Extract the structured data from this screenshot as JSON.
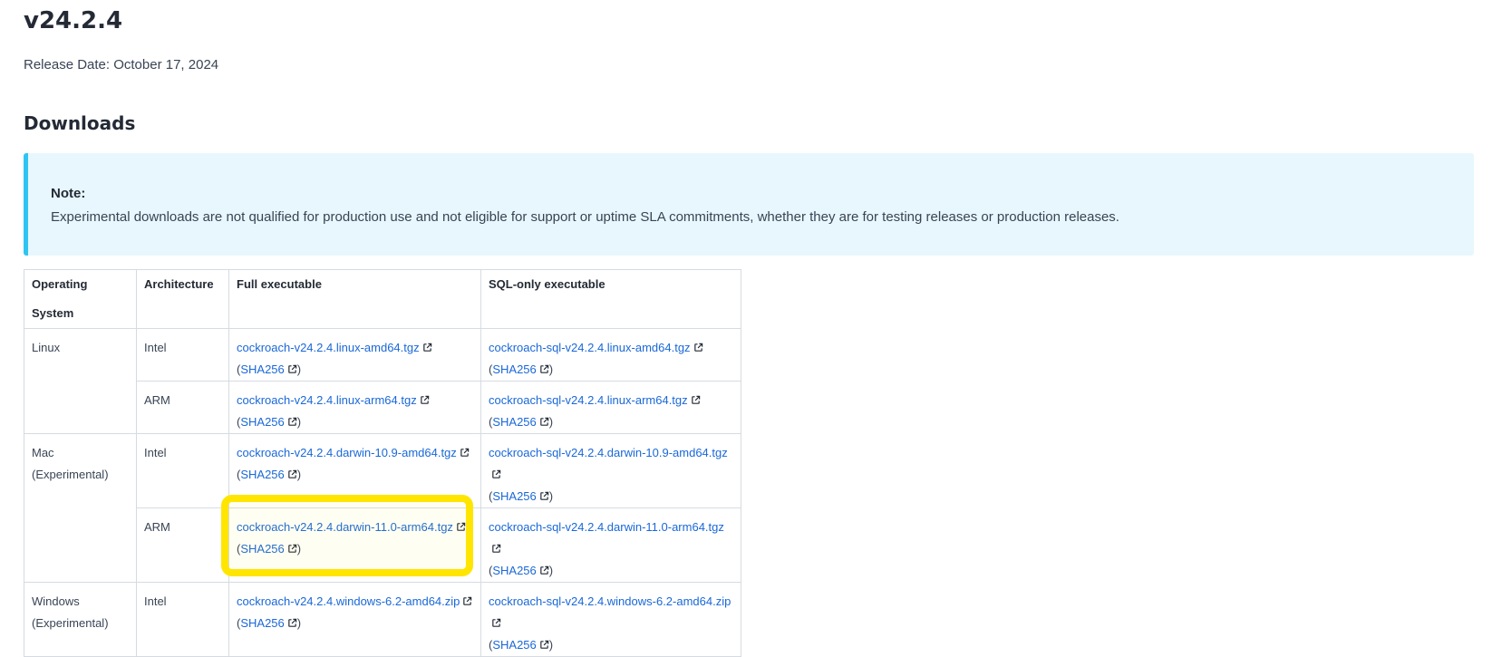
{
  "version_title": "v24.2.4",
  "release_date": "Release Date: October 17, 2024",
  "downloads_heading": "Downloads",
  "note": {
    "title": "Note:",
    "text": "Experimental downloads are not qualified for production use and not eligible for support or uptime SLA commitments, whether they are for testing releases or production releases."
  },
  "table": {
    "headers": [
      "Operating System",
      "Architecture",
      "Full executable",
      "SQL-only executable"
    ],
    "sha_label": "SHA256",
    "rows": [
      {
        "os": "Linux",
        "os_sub": "",
        "arch": "Intel",
        "full": "cockroach-v24.2.4.linux-amd64.tgz",
        "sql": "cockroach-sql-v24.2.4.linux-amd64.tgz"
      },
      {
        "os": "",
        "os_sub": "",
        "arch": "ARM",
        "full": "cockroach-v24.2.4.linux-arm64.tgz",
        "sql": "cockroach-sql-v24.2.4.linux-arm64.tgz"
      },
      {
        "os": "Mac",
        "os_sub": "(Experimental)",
        "arch": "Intel",
        "full": "cockroach-v24.2.4.darwin-10.9-amd64.tgz",
        "sql": "cockroach-sql-v24.2.4.darwin-10.9-amd64.tgz"
      },
      {
        "os": "",
        "os_sub": "",
        "arch": "ARM",
        "full": "cockroach-v24.2.4.darwin-11.0-arm64.tgz",
        "sql": "cockroach-sql-v24.2.4.darwin-11.0-arm64.tgz"
      },
      {
        "os": "Windows",
        "os_sub": "(Experimental)",
        "arch": "Intel",
        "full": "cockroach-v24.2.4.windows-6.2-amd64.zip",
        "sql": "cockroach-sql-v24.2.4.windows-6.2-amd64.zip"
      }
    ]
  },
  "colors": {
    "link": "#1a68d8",
    "note_bg": "#e8f7fd",
    "note_border": "#2fc5f2",
    "highlight": "#ffe500"
  },
  "icons": {
    "external_link": "external-link-icon"
  }
}
